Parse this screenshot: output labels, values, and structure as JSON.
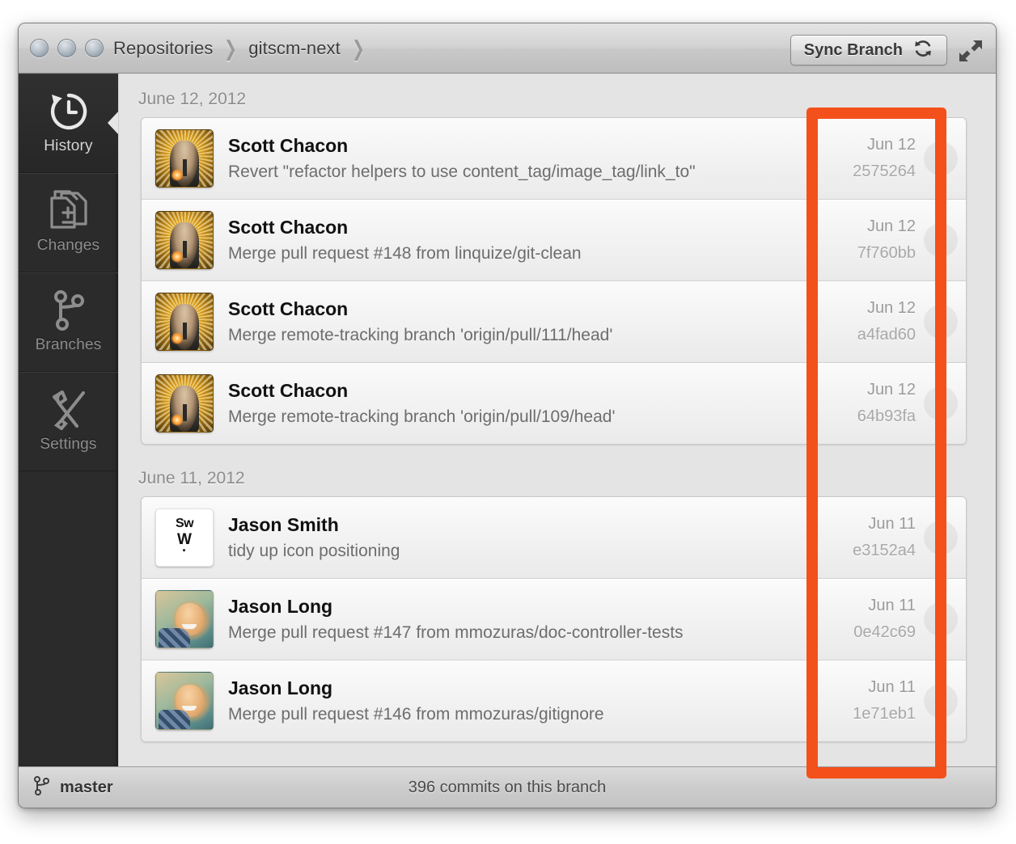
{
  "window": {
    "traffic_lights": [
      "close",
      "minimize",
      "zoom"
    ],
    "breadcrumb": [
      {
        "label": "Repositories"
      },
      {
        "label": "gitscm-next"
      }
    ],
    "breadcrumb_separator": "❯",
    "sync_button": {
      "label": "Sync Branch",
      "icon": "refresh-icon"
    },
    "fullscreen_button": {
      "icon": "fullscreen-arrows-icon"
    }
  },
  "sidebar": {
    "items": [
      {
        "label": "History",
        "icon": "history-clock-icon",
        "active": true
      },
      {
        "label": "Changes",
        "icon": "file-plus-minus-icon",
        "active": false
      },
      {
        "label": "Branches",
        "icon": "branch-fork-icon",
        "active": false
      },
      {
        "label": "Settings",
        "icon": "wrench-screwdriver-icon",
        "active": false
      }
    ]
  },
  "main": {
    "groups": [
      {
        "date_header": "June 12, 2012",
        "commits": [
          {
            "author": "Scott Chacon",
            "message": "Revert \"refactor helpers to use content_tag/image_tag/link_to\"",
            "date": "Jun 12",
            "sha": "2575264",
            "avatar": "scott-chacon-avatar"
          },
          {
            "author": "Scott Chacon",
            "message": "Merge pull request #148 from linquize/git-clean",
            "date": "Jun 12",
            "sha": "7f760bb",
            "avatar": "scott-chacon-avatar"
          },
          {
            "author": "Scott Chacon",
            "message": "Merge remote-tracking branch 'origin/pull/111/head'",
            "date": "Jun 12",
            "sha": "a4fad60",
            "avatar": "scott-chacon-avatar"
          },
          {
            "author": "Scott Chacon",
            "message": "Merge remote-tracking branch 'origin/pull/109/head'",
            "date": "Jun 12",
            "sha": "64b93fa",
            "avatar": "scott-chacon-avatar"
          }
        ]
      },
      {
        "date_header": "June 11, 2012",
        "commits": [
          {
            "author": "Jason Smith",
            "message": "tidy up icon positioning",
            "date": "Jun 11",
            "sha": "e3152a4",
            "avatar": "jason-smith-avatar"
          },
          {
            "author": "Jason Long",
            "message": "Merge pull request #147 from mmozuras/doc-controller-tests",
            "date": "Jun 11",
            "sha": "0e42c69",
            "avatar": "jason-long-avatar"
          },
          {
            "author": "Jason Long",
            "message": "Merge pull request #146 from mmozuras/gitignore",
            "date": "Jun 11",
            "sha": "1e71eb1",
            "avatar": "jason-long-avatar"
          }
        ]
      }
    ]
  },
  "avatar_initials": {
    "jason_smith": {
      "line1": "Sw",
      "line2": "W",
      "line3": "·"
    }
  },
  "statusbar": {
    "branch_icon": "branch-fork-icon",
    "branch_name": "master",
    "commit_count_text": "396 commits on this branch"
  },
  "annotation": {
    "color": "#F4501B",
    "shape": "rectangle-outline",
    "target": "commit-metadata-column"
  }
}
